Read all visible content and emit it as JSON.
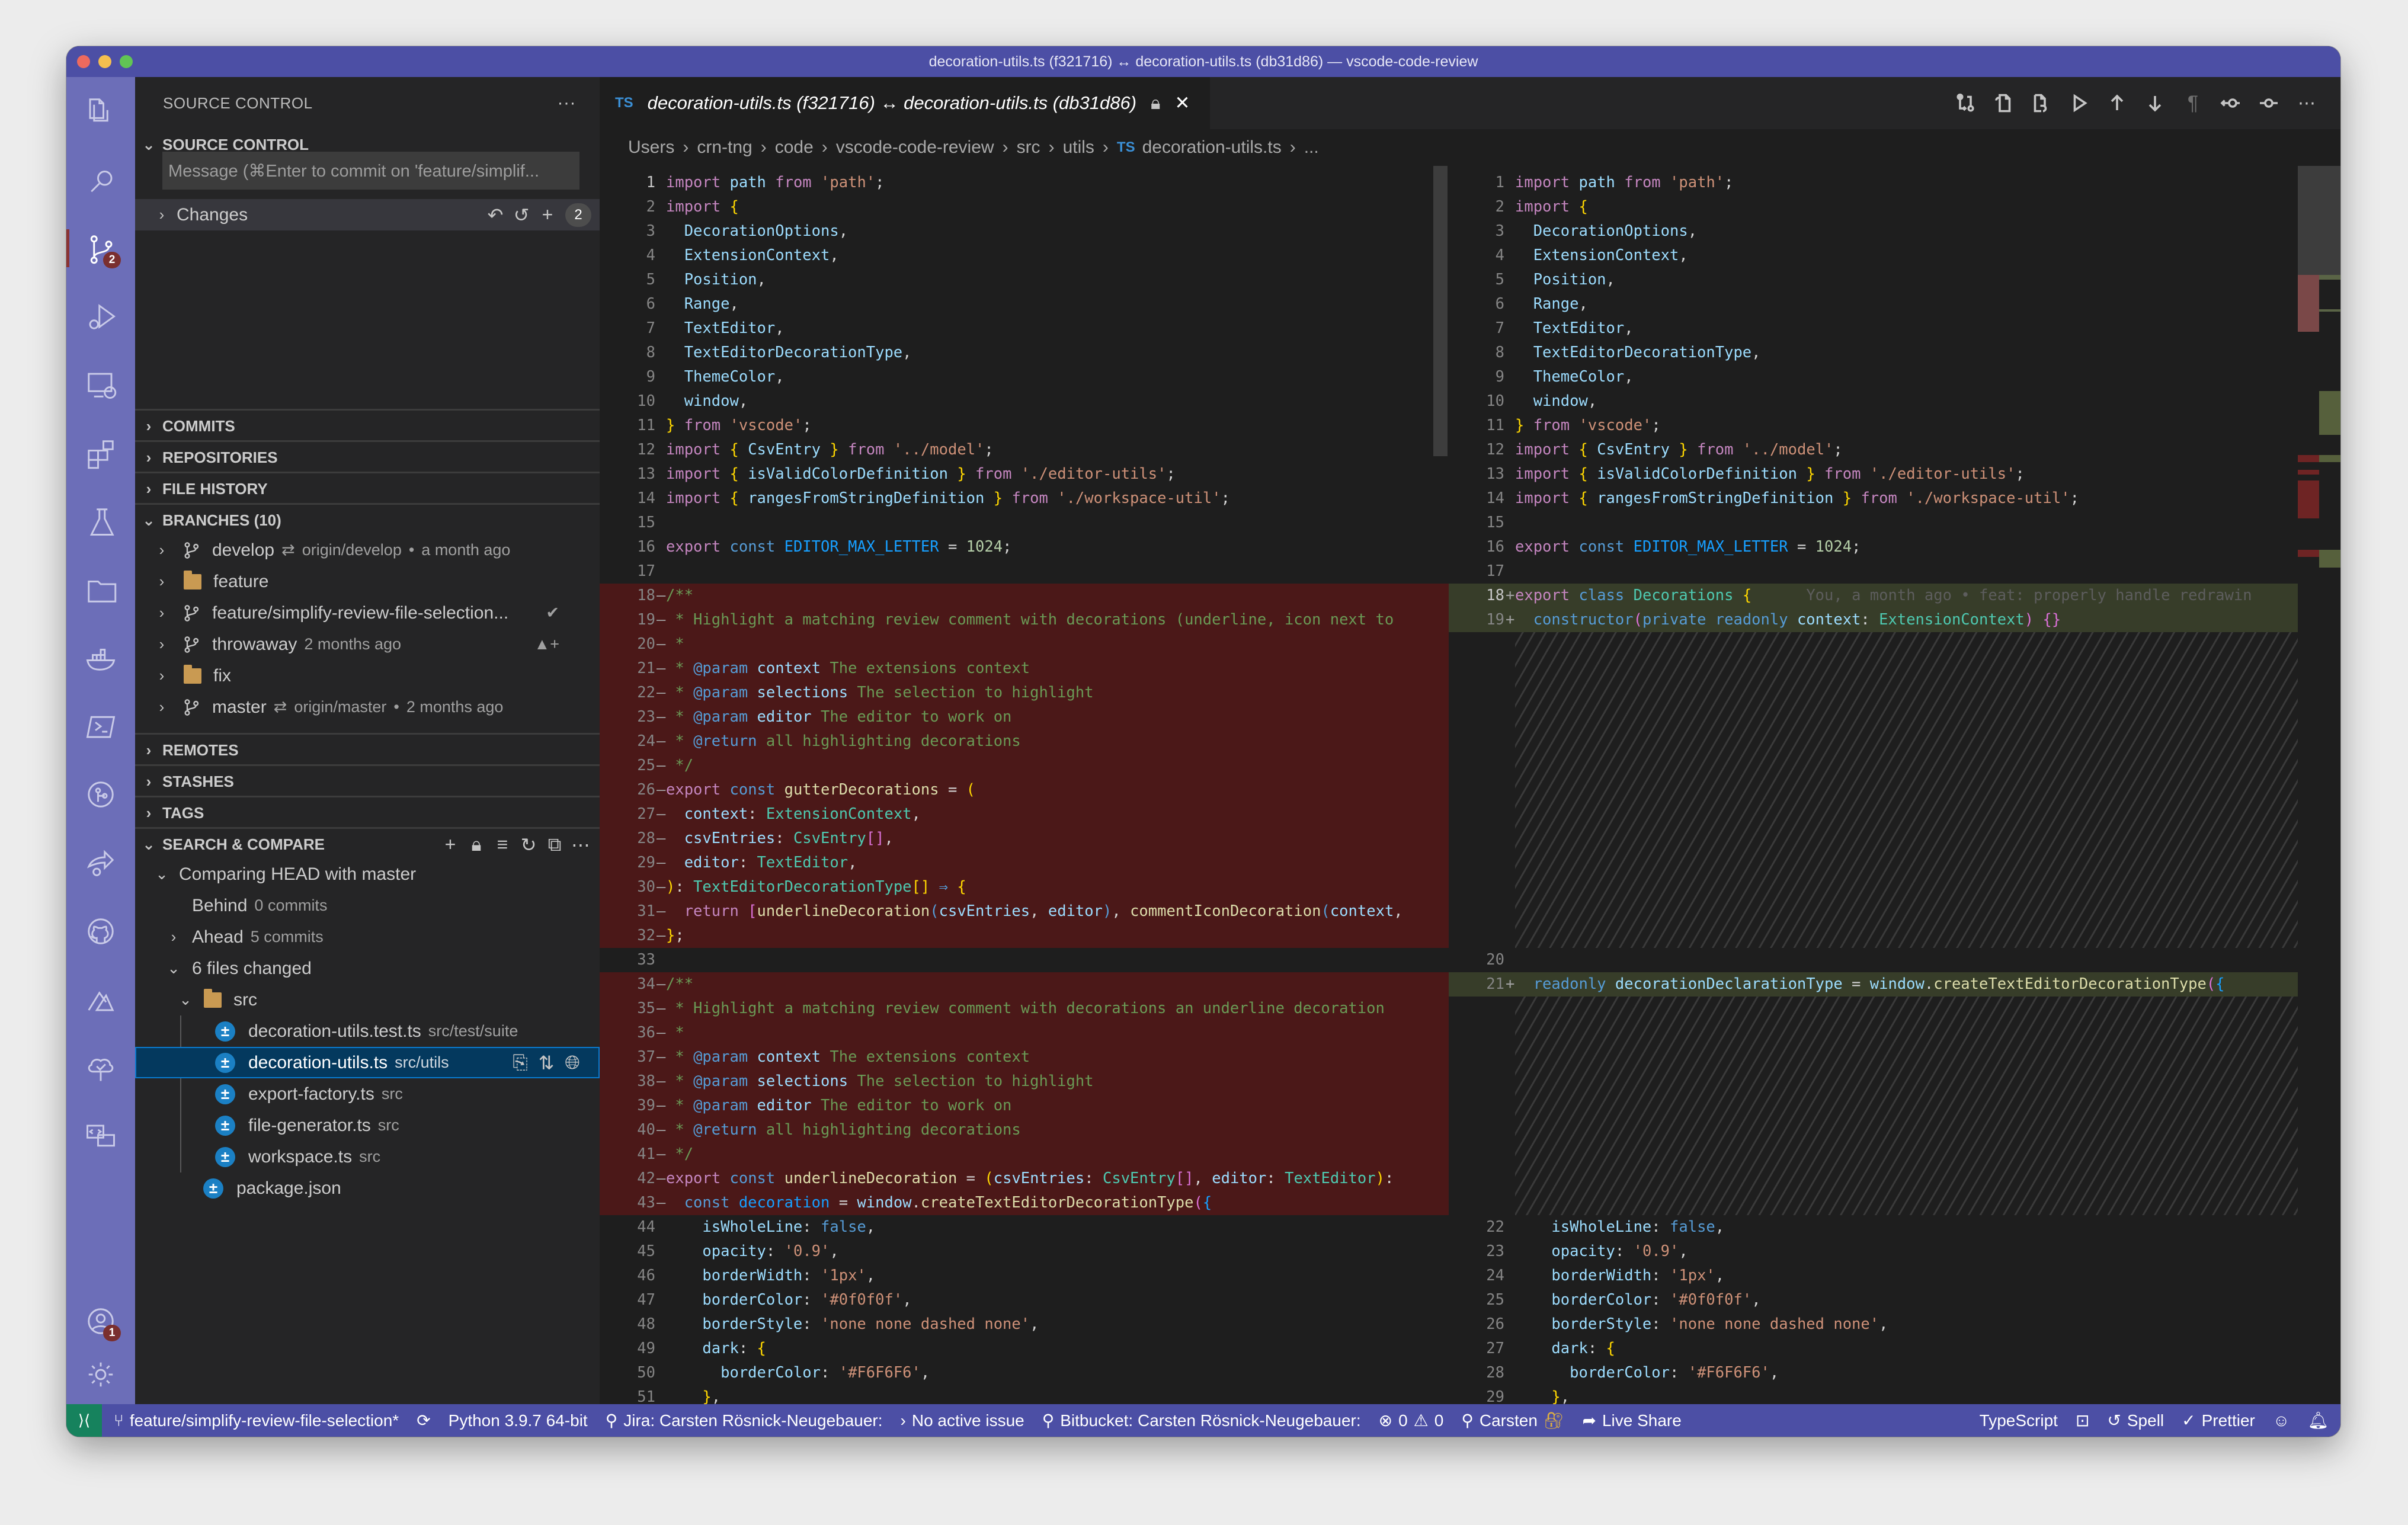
{
  "window": {
    "title": "decoration-utils.ts (f321716) ↔ decoration-utils.ts (db31d86) — vscode-code-review"
  },
  "activity_bar": {
    "items": [
      {
        "name": "explorer-icon"
      },
      {
        "name": "search-icon"
      },
      {
        "name": "source-control-icon",
        "badge": "2",
        "active": true
      },
      {
        "name": "run-debug-icon"
      },
      {
        "name": "remote-explorer-icon"
      },
      {
        "name": "extensions-icon"
      },
      {
        "name": "testing-icon"
      },
      {
        "name": "project-manager-icon"
      },
      {
        "name": "docker-icon"
      },
      {
        "name": "terminal-icon"
      },
      {
        "name": "gitlens-icon"
      },
      {
        "name": "live-share-icon"
      },
      {
        "name": "github-icon"
      },
      {
        "name": "atlassian-icon"
      },
      {
        "name": "tree-check-icon"
      },
      {
        "name": "html-preview-icon"
      }
    ],
    "accounts_badge": "1"
  },
  "sidebar": {
    "title": "SOURCE CONTROL",
    "more": "···",
    "source_control_header": "SOURCE CONTROL",
    "commit_placeholder": "Message (⌘Enter to commit on 'feature/simplif...",
    "changes": {
      "label": "Changes",
      "count": "2"
    },
    "sections": {
      "commits": "COMMITS",
      "repositories": "REPOSITORIES",
      "file_history": "FILE HISTORY",
      "branches": "BRANCHES (10)",
      "remotes": "REMOTES",
      "stashes": "STASHES",
      "tags": "TAGS",
      "search_compare": "SEARCH & COMPARE"
    },
    "branches": [
      {
        "name": "develop",
        "type": "branch",
        "tracking": "⇄",
        "remote": "origin/develop",
        "dot": "•",
        "when": "a month ago",
        "status": ""
      },
      {
        "name": "feature",
        "type": "folder",
        "tracking": "",
        "remote": "",
        "dot": "",
        "when": "",
        "status": ""
      },
      {
        "name": "feature/simplify-review-file-selection...",
        "type": "branch",
        "tracking": "",
        "remote": "",
        "dot": "",
        "when": "",
        "status": "✔"
      },
      {
        "name": "throwaway",
        "type": "branch",
        "tracking": "",
        "remote": "",
        "dot": "",
        "when": "2 months ago",
        "status": "▲+"
      },
      {
        "name": "fix",
        "type": "folder",
        "tracking": "",
        "remote": "",
        "dot": "",
        "when": "",
        "status": ""
      },
      {
        "name": "master",
        "type": "branch",
        "tracking": "⇄",
        "remote": "origin/master",
        "dot": "•",
        "when": "2 months ago",
        "status": ""
      }
    ],
    "compare": {
      "title": "Comparing HEAD with master",
      "behind_label": "Behind",
      "behind_value": "0 commits",
      "ahead_label": "Ahead",
      "ahead_value": "5 commits",
      "files_changed": "6 files changed",
      "folder": "src",
      "files": [
        {
          "name": "decoration-utils.test.ts",
          "path": "src/test/suite",
          "selected": false
        },
        {
          "name": "decoration-utils.ts",
          "path": "src/utils",
          "selected": true
        },
        {
          "name": "export-factory.ts",
          "path": "src",
          "selected": false
        },
        {
          "name": "file-generator.ts",
          "path": "src",
          "selected": false
        },
        {
          "name": "workspace.ts",
          "path": "src",
          "selected": false
        }
      ],
      "root_file": "package.json"
    }
  },
  "editor": {
    "tab": {
      "lang": "TS",
      "label": "decoration-utils.ts (f321716) ↔ decoration-utils.ts (db31d86)"
    },
    "breadcrumb": [
      "Users",
      "crn-tng",
      "code",
      "vscode-code-review",
      "src",
      "utils",
      "decoration-utils.ts",
      "..."
    ],
    "blame": "You, a month ago • feat: properly handle redrawin"
  },
  "status_bar": {
    "branch": "feature/simplify-review-file-selection*",
    "python": "Python 3.9.7 64-bit",
    "jira": "Jira: Carsten Rösnick-Neugebauer:",
    "issue": "No active issue",
    "bitbucket": "Bitbucket: Carsten Rösnick-Neugebauer:",
    "errors": "0",
    "warnings": "0",
    "user": "Carsten",
    "live_share": "Live Share",
    "language": "TypeScript",
    "spell": "Spell",
    "prettier": "Prettier"
  },
  "colors": {
    "title_bar": "#4c4fa5",
    "activity_bar": "#6c6eb8",
    "remote_indicator": "#16825d",
    "deleted_line": "#4b1818",
    "inserted_line": "#373d29"
  }
}
